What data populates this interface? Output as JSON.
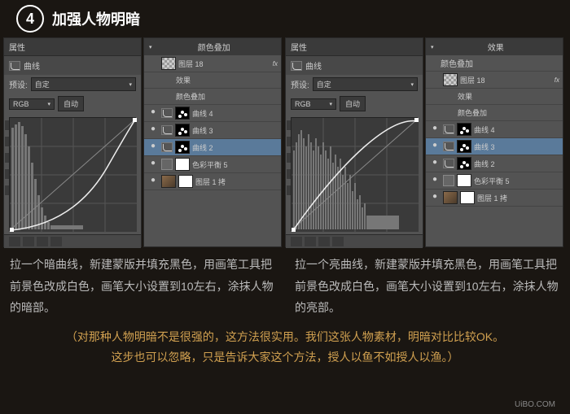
{
  "header": {
    "num": "4",
    "title": "加强人物明暗"
  },
  "left": {
    "prop": {
      "tab": "属性",
      "name": "曲线",
      "preset_label": "预设:",
      "preset": "自定",
      "channel": "RGB",
      "auto": "自动"
    },
    "layers": {
      "tab": "颜色叠加",
      "items": [
        {
          "thumb": "checker",
          "name": "图层 18",
          "fx": "fx"
        },
        {
          "indent": 1,
          "name": "效果"
        },
        {
          "indent": 1,
          "name": "颜色叠加"
        },
        {
          "eye": "●",
          "curve": 1,
          "mask": "spots",
          "name": "曲线 4"
        },
        {
          "eye": "●",
          "curve": 1,
          "mask": "spots",
          "name": "曲线 3"
        },
        {
          "eye": "●",
          "curve": 1,
          "mask": "spots",
          "name": "曲线 2",
          "sel": 1
        },
        {
          "eye": "●",
          "bal": 1,
          "mask": "white",
          "name": "色彩平衡 5"
        },
        {
          "eye": "●",
          "thumb": "img",
          "mask": "white",
          "name": "图层 1 拷"
        }
      ]
    },
    "caption": "拉一个暗曲线，新建蒙版并填充黑色，用画笔工具把前景色改成白色，画笔大小设置到10左右，涂抹人物的暗部。"
  },
  "right": {
    "prop": {
      "tab": "属性",
      "name": "曲线",
      "preset_label": "预设:",
      "preset": "自定",
      "channel": "RGB",
      "auto": "自动"
    },
    "layers": {
      "tab": "效果",
      "tab2": "颜色叠加",
      "items": [
        {
          "thumb": "checker",
          "name": "图层 18",
          "fx": "fx"
        },
        {
          "indent": 1,
          "name": "效果"
        },
        {
          "indent": 1,
          "name": "颜色叠加"
        },
        {
          "eye": "●",
          "curve": 1,
          "mask": "spots",
          "name": "曲线 4"
        },
        {
          "eye": "●",
          "curve": 1,
          "mask": "spots",
          "name": "曲线 3",
          "sel": 1
        },
        {
          "eye": "●",
          "curve": 1,
          "mask": "spots",
          "name": "曲线 2"
        },
        {
          "eye": "●",
          "bal": 1,
          "mask": "white",
          "name": "色彩平衡 5"
        },
        {
          "eye": "●",
          "thumb": "img",
          "mask": "white",
          "name": "图层 1 拷"
        }
      ]
    },
    "caption": "拉一个亮曲线，新建蒙版并填充黑色，用画笔工具把前景色改成白色，画笔大小设置到10左右，涂抹人物的亮部。"
  },
  "footer": {
    "line1": "（对那种人物明暗不是很强的，这方法很实用。我们这张人物素材，明暗对比比较OK。",
    "line2": "这步也可以忽略，只是告诉大家这个方法，授人以鱼不如授人以渔。）"
  },
  "watermark": "UiBO.COM"
}
